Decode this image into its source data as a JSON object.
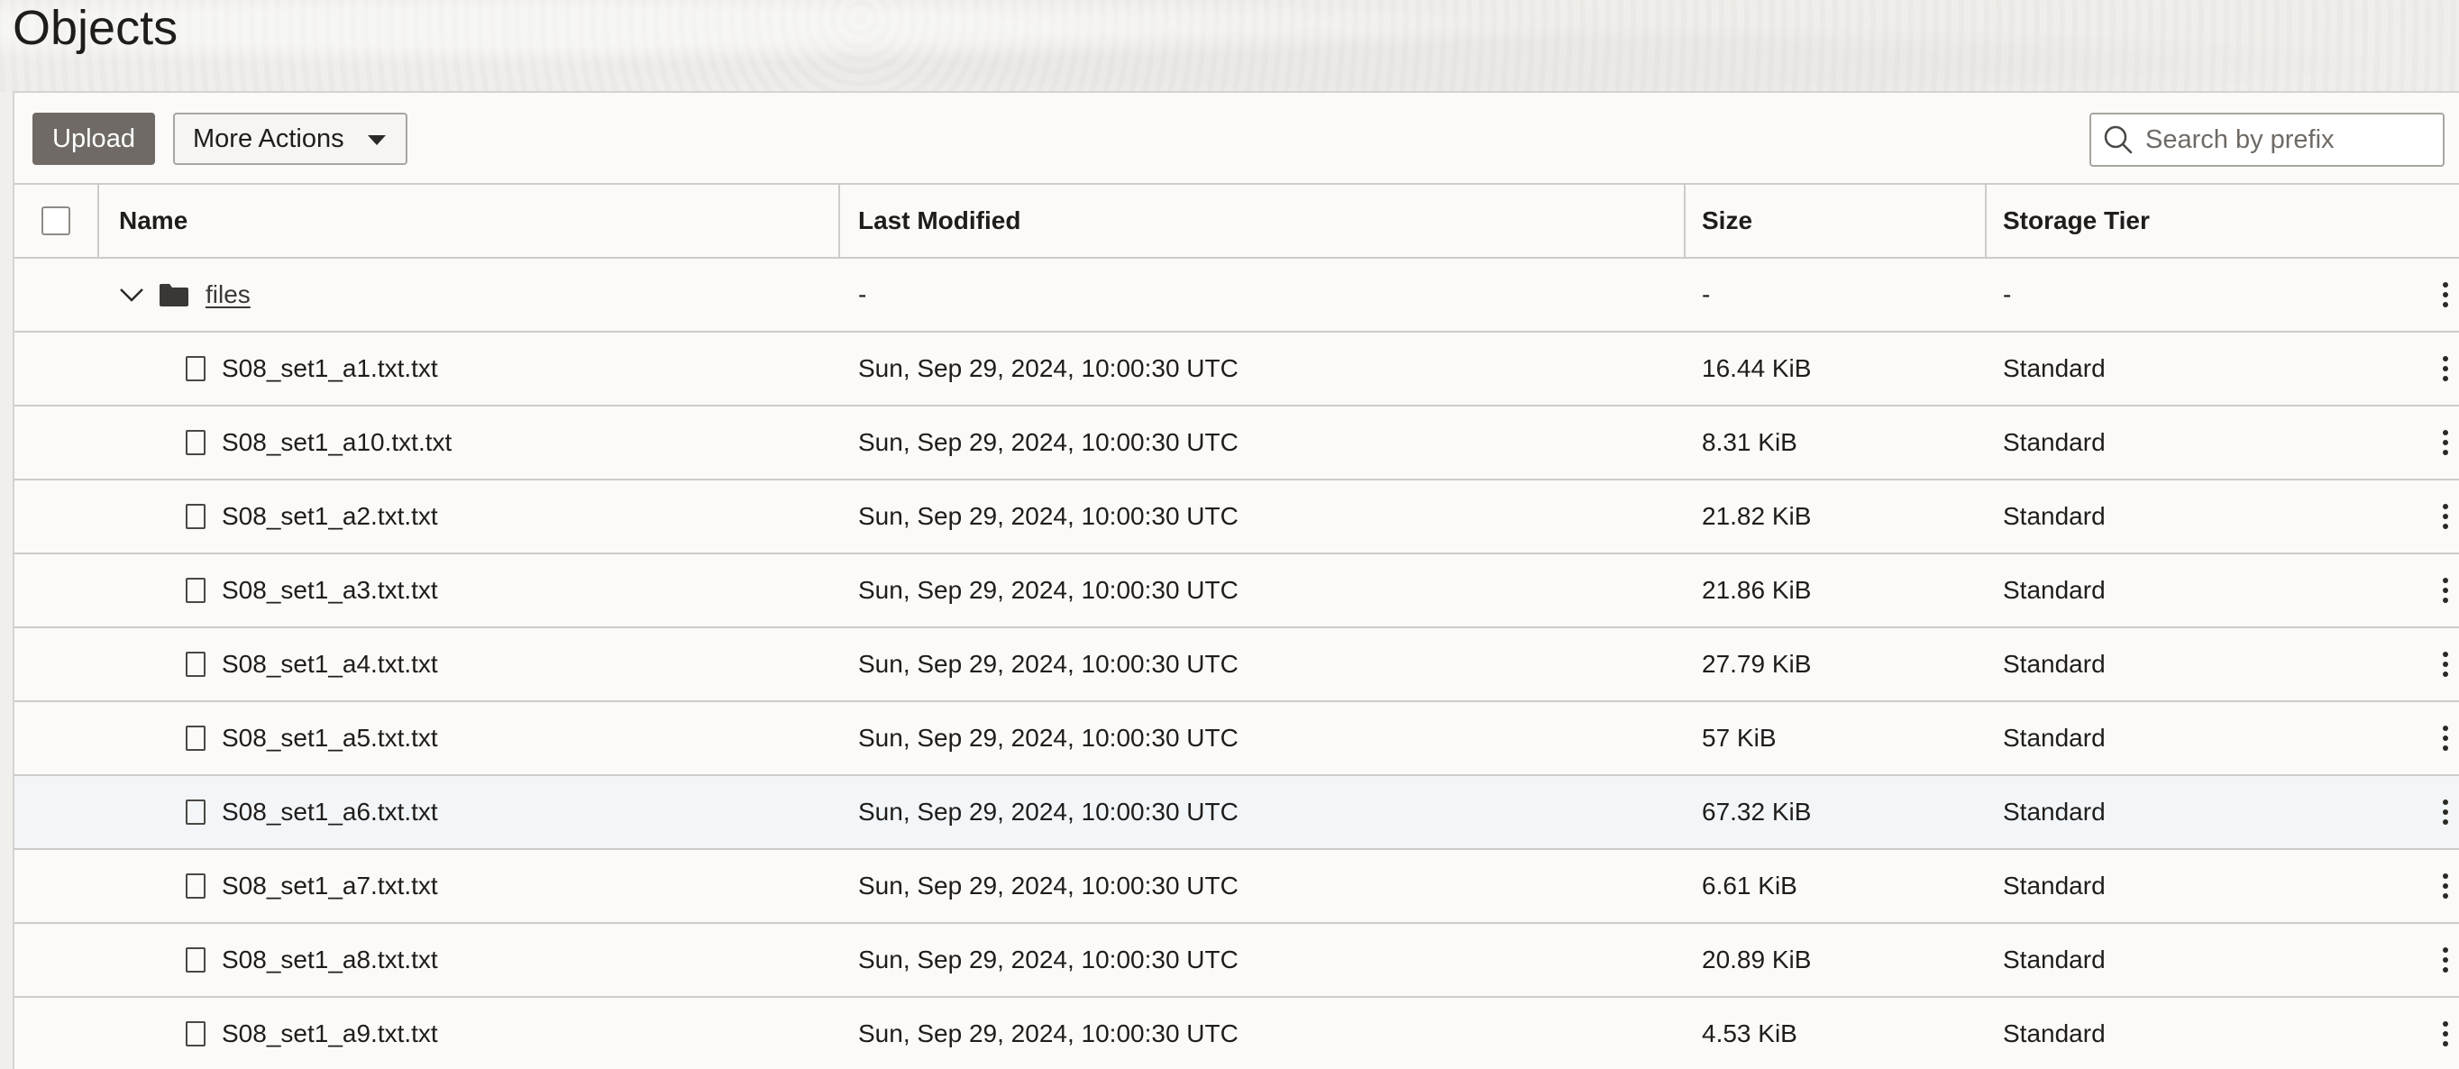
{
  "page": {
    "title": "Objects"
  },
  "toolbar": {
    "upload_label": "Upload",
    "more_actions_label": "More Actions",
    "search_placeholder": "Search by prefix",
    "search_value": ""
  },
  "table": {
    "columns": [
      "Name",
      "Last Modified",
      "Size",
      "Storage Tier"
    ],
    "folder": {
      "name": "files",
      "last_modified": "-",
      "size": "-",
      "tier": "-",
      "expanded": true
    },
    "rows": [
      {
        "name": "S08_set1_a1.txt.txt",
        "last_modified": "Sun, Sep 29, 2024, 10:00:30 UTC",
        "size": "16.44 KiB",
        "tier": "Standard"
      },
      {
        "name": "S08_set1_a10.txt.txt",
        "last_modified": "Sun, Sep 29, 2024, 10:00:30 UTC",
        "size": "8.31 KiB",
        "tier": "Standard"
      },
      {
        "name": "S08_set1_a2.txt.txt",
        "last_modified": "Sun, Sep 29, 2024, 10:00:30 UTC",
        "size": "21.82 KiB",
        "tier": "Standard"
      },
      {
        "name": "S08_set1_a3.txt.txt",
        "last_modified": "Sun, Sep 29, 2024, 10:00:30 UTC",
        "size": "21.86 KiB",
        "tier": "Standard"
      },
      {
        "name": "S08_set1_a4.txt.txt",
        "last_modified": "Sun, Sep 29, 2024, 10:00:30 UTC",
        "size": "27.79 KiB",
        "tier": "Standard"
      },
      {
        "name": "S08_set1_a5.txt.txt",
        "last_modified": "Sun, Sep 29, 2024, 10:00:30 UTC",
        "size": "57 KiB",
        "tier": "Standard"
      },
      {
        "name": "S08_set1_a6.txt.txt",
        "last_modified": "Sun, Sep 29, 2024, 10:00:30 UTC",
        "size": "67.32 KiB",
        "tier": "Standard",
        "highlighted": true
      },
      {
        "name": "S08_set1_a7.txt.txt",
        "last_modified": "Sun, Sep 29, 2024, 10:00:30 UTC",
        "size": "6.61 KiB",
        "tier": "Standard"
      },
      {
        "name": "S08_set1_a8.txt.txt",
        "last_modified": "Sun, Sep 29, 2024, 10:00:30 UTC",
        "size": "20.89 KiB",
        "tier": "Standard"
      },
      {
        "name": "S08_set1_a9.txt.txt",
        "last_modified": "Sun, Sep 29, 2024, 10:00:30 UTC",
        "size": "4.53 KiB",
        "tier": "Standard"
      }
    ]
  },
  "icons": {
    "search": "search-icon",
    "caret": "caret-down-icon",
    "chevron": "chevron-down-icon",
    "folder": "folder-icon",
    "file": "file-icon",
    "row_menu": "kebab-menu-icon"
  },
  "colors": {
    "upload_button_bg": "#6f6a65",
    "row_highlight_bg": "#f3f6f8",
    "page_bg": "#f1efec"
  }
}
